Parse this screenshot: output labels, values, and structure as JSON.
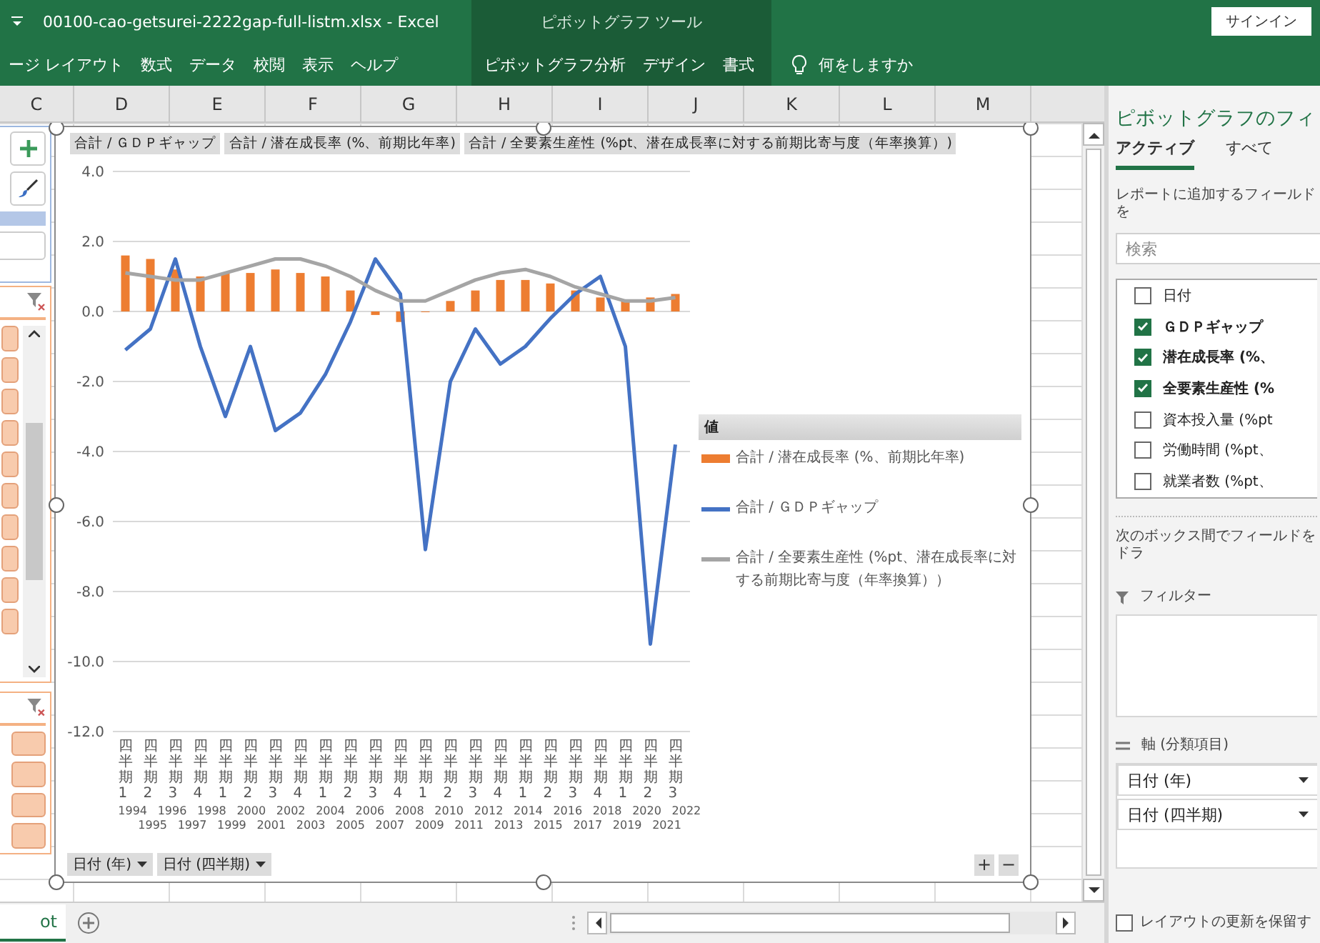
{
  "title_bar": {
    "file_title": "00100-cao-getsurei-2222gap-full-listm.xlsx  -  Excel",
    "context_title": "ピボットグラフ ツール",
    "sign_in": "サインイン"
  },
  "ribbon_tabs": [
    {
      "label": "ージ レイアウト",
      "contextual": false
    },
    {
      "label": "数式",
      "contextual": false
    },
    {
      "label": "データ",
      "contextual": false
    },
    {
      "label": "校閲",
      "contextual": false
    },
    {
      "label": "表示",
      "contextual": false
    },
    {
      "label": "ヘルプ",
      "contextual": false
    },
    {
      "label": "ピボットグラフ分析",
      "contextual": true
    },
    {
      "label": "デザイン",
      "contextual": true
    },
    {
      "label": "書式",
      "contextual": true
    }
  ],
  "tell_me": "何をしますか",
  "columns": [
    "C",
    "D",
    "E",
    "F",
    "G",
    "H",
    "I",
    "J",
    "K",
    "L",
    "M"
  ],
  "chart": {
    "field_buttons": [
      "合計 / ＧＤＰギャップ",
      "合計 / 潜在成長率 (%、前期比年率)",
      "合計 / 全要素生産性 (%pt、潜在成長率に対する前期比寄与度（年率換算）)"
    ],
    "legend_title": "値",
    "chart_data": {
      "type": "line",
      "categories": [
        "四半期1",
        "四半期2",
        "四半期3",
        "四半期4",
        "四半期1",
        "四半期2",
        "四半期3",
        "四半期4",
        "四半期1",
        "四半期2",
        "四半期3",
        "四半期4",
        "四半期1",
        "四半期2",
        "四半期3",
        "四半期4",
        "四半期1",
        "四半期2",
        "四半期3",
        "四半期4",
        "四半期1",
        "四半期2",
        "四半期3"
      ],
      "series": [
        {
          "name": "合計 / 潜在成長率 (%、前期比年率)",
          "type": "bar",
          "color": "#ed7d31",
          "values": [
            1.6,
            1.5,
            1.2,
            1.0,
            1.1,
            1.1,
            1.2,
            1.1,
            1.0,
            0.6,
            -0.1,
            -0.3,
            0.0,
            0.3,
            0.6,
            0.9,
            0.9,
            0.8,
            0.6,
            0.4,
            0.3,
            0.4,
            0.5
          ]
        },
        {
          "name": "合計 / ＧＤＰギャップ",
          "color": "#4472c4",
          "values": [
            -1.1,
            -0.5,
            1.5,
            -1.0,
            -3.0,
            -1.0,
            -3.4,
            -2.9,
            -1.8,
            -0.3,
            1.5,
            0.5,
            -6.8,
            -2.0,
            -0.5,
            -1.5,
            -1.0,
            -0.2,
            0.5,
            1.0,
            -1.0,
            -9.5,
            -3.8
          ]
        },
        {
          "name": "合計 / 全要素生産性 (%pt、潜在成長率に対する前期比寄与度（年率換算））",
          "color": "#a5a5a5",
          "values": [
            1.1,
            1.0,
            0.9,
            0.9,
            1.1,
            1.3,
            1.5,
            1.5,
            1.3,
            1.0,
            0.6,
            0.3,
            0.3,
            0.6,
            0.9,
            1.1,
            1.2,
            1.0,
            0.7,
            0.5,
            0.3,
            0.3,
            0.4
          ]
        }
      ],
      "ylim": [
        -12,
        4
      ],
      "grid": true,
      "yticks": [
        {
          "value": 4,
          "label": "4.0"
        },
        {
          "value": 2,
          "label": "2.0"
        },
        {
          "value": 0,
          "label": "0.0"
        },
        {
          "value": -2,
          "label": "-2.0"
        },
        {
          "value": -4,
          "label": "-4.0"
        },
        {
          "value": -6,
          "label": "-6.0"
        },
        {
          "value": -8,
          "label": "-8.0"
        },
        {
          "value": -10,
          "label": "-10.0"
        },
        {
          "value": -12,
          "label": "-12.0"
        }
      ]
    },
    "year_labels": [
      "1994",
      "1995",
      "1996",
      "1997",
      "1998",
      "1999",
      "2000",
      "2001",
      "2002",
      "2003",
      "2004",
      "2005",
      "2006",
      "2007",
      "2008",
      "2009",
      "2010",
      "2011",
      "2012",
      "2013",
      "2014",
      "2015",
      "2016",
      "2017",
      "2018",
      "2019",
      "2020",
      "2021",
      "2022"
    ],
    "axis_buttons": [
      "日付 (年)",
      "日付 (四半期)"
    ],
    "zoom_buttons": [
      "+",
      "−"
    ]
  },
  "sheet_tab": "ot",
  "field_pane": {
    "title": "ピボットグラフのフィ",
    "tabs": [
      {
        "label": "アクティブ",
        "selected": true
      },
      {
        "label": "すべて",
        "selected": false
      }
    ],
    "instruction": "レポートに追加するフィールドを",
    "search": {
      "placeholder": "検索"
    },
    "fields": [
      {
        "label": "日付",
        "checked": false
      },
      {
        "label": "ＧＤＰギャップ",
        "checked": true
      },
      {
        "label": "潜在成長率 (%、",
        "checked": true
      },
      {
        "label": "全要素生産性 (%",
        "checked": true
      },
      {
        "label": "資本投入量 (%pt",
        "checked": false
      },
      {
        "label": "労働時間 (%pt、",
        "checked": false
      },
      {
        "label": "就業者数 (%pt、",
        "checked": false
      }
    ],
    "areas_hint": "次のボックス間でフィールドをドラ",
    "filter_area": {
      "label": "フィルター"
    },
    "axis_area": {
      "label": "軸 (分類項目)",
      "items": [
        "日付 (年)",
        "日付 (四半期)"
      ]
    },
    "defer_update": {
      "label": "レイアウトの更新を保留す",
      "checked": false
    }
  }
}
